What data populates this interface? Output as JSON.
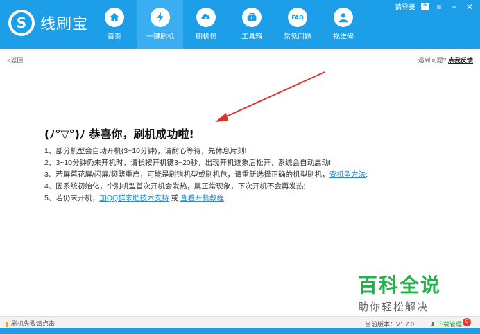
{
  "app": {
    "name": "线刷宝",
    "logo_letter": "S"
  },
  "titlebar": {
    "login": "请登录",
    "help": "?"
  },
  "nav": [
    {
      "label": "首页",
      "icon": "home-icon"
    },
    {
      "label": "一键刷机",
      "icon": "lightning-icon"
    },
    {
      "label": "刷机包",
      "icon": "cloud-download-icon"
    },
    {
      "label": "工具箱",
      "icon": "toolbox-icon"
    },
    {
      "label": "常见问题",
      "icon": "faq-icon",
      "icon_text": "FAQ"
    },
    {
      "label": "找维修",
      "icon": "repair-person-icon"
    }
  ],
  "active_nav": "一键刷机",
  "subbar": {
    "back": "<返回",
    "problem": "遇到问题?",
    "feedback": "点我反馈"
  },
  "content": {
    "headline": "(ﾉ°▽°)ﾉ 恭喜你，刷机成功啦!",
    "step1": "1、部分机型会自动开机(3~10分钟)，请耐心等待，先休息片刻!",
    "step2": "2、3~10分钟仍未开机时，请长按开机键3~20秒，出现开机迹象后松开，系统会自动启动!",
    "step3_text": "3、若屏幕花屏/闪屏/频繁重启，可能是刷错机型或刷机包，请重新选择正确的机型刷机，",
    "step3_link": "查机型方法",
    "step3_end": ";",
    "step4": "4、因系统初始化，个别机型首次开机会发热，属正常现象，下次开机不会再发热;",
    "step5_text": "5、若仍未开机，",
    "step5_link1": "加QQ群求助技术支持",
    "step5_or": " 或 ",
    "step5_link2": "查看开机教程",
    "step5_end": ";"
  },
  "watermark": {
    "title": "百科全说",
    "subtitle": "助你轻松解决"
  },
  "statusbar": {
    "fail": "刷机失败请点击",
    "version_label": "当前版本：",
    "version": "V1.7.0",
    "download": "下载管理",
    "badge": "0"
  },
  "colors": {
    "brand": "#1d9ee8",
    "link": "#1a8fd8",
    "arrow": "#e8302a",
    "watermark": "#22b24c"
  }
}
